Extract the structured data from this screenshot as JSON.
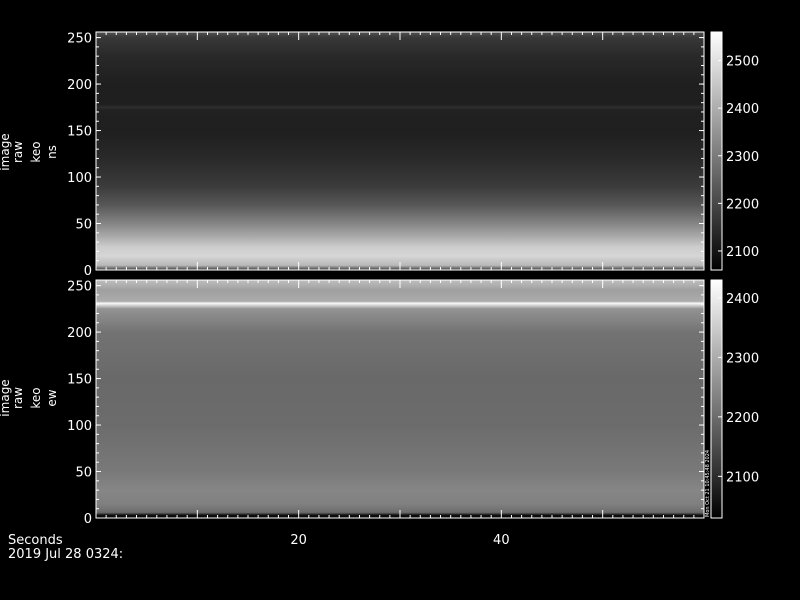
{
  "chart_data": [
    {
      "type": "heatmap",
      "ylabel_lines": [
        "image",
        "raw",
        "keo",
        "ns"
      ],
      "y_ticks": [
        0,
        50,
        100,
        150,
        200,
        250
      ],
      "ylim": [
        0,
        256
      ],
      "xlim": [
        0,
        60
      ],
      "colorbar": {
        "ticks": [
          2100,
          2200,
          2300,
          2400,
          2500
        ],
        "range": [
          2060,
          2560
        ],
        "palette": "grayscale"
      },
      "row_profile": [
        {
          "y": 0,
          "v": 2180
        },
        {
          "y": 5,
          "v": 2420
        },
        {
          "y": 15,
          "v": 2480
        },
        {
          "y": 25,
          "v": 2460
        },
        {
          "y": 35,
          "v": 2400
        },
        {
          "y": 50,
          "v": 2320
        },
        {
          "y": 70,
          "v": 2230
        },
        {
          "y": 90,
          "v": 2175
        },
        {
          "y": 120,
          "v": 2140
        },
        {
          "y": 150,
          "v": 2120
        },
        {
          "y": 172,
          "v": 2125
        },
        {
          "y": 175,
          "v": 2150
        },
        {
          "y": 178,
          "v": 2120
        },
        {
          "y": 200,
          "v": 2120
        },
        {
          "y": 230,
          "v": 2140
        },
        {
          "y": 250,
          "v": 2170
        },
        {
          "y": 256,
          "v": 2220
        }
      ]
    },
    {
      "type": "heatmap",
      "ylabel_lines": [
        "image",
        "raw",
        "keo",
        "ew"
      ],
      "y_ticks": [
        0,
        50,
        100,
        150,
        200,
        250
      ],
      "ylim": [
        0,
        256
      ],
      "xlim": [
        0,
        60
      ],
      "colorbar": {
        "ticks": [
          2100,
          2200,
          2300,
          2400
        ],
        "range": [
          2030,
          2430
        ],
        "palette": "grayscale"
      },
      "colorbar_annotation": "Mon Oct 21 10:45:48 2024",
      "row_profile": [
        {
          "y": 0,
          "v": 2040
        },
        {
          "y": 3,
          "v": 2050
        },
        {
          "y": 6,
          "v": 2200
        },
        {
          "y": 15,
          "v": 2230
        },
        {
          "y": 30,
          "v": 2240
        },
        {
          "y": 50,
          "v": 2220
        },
        {
          "y": 100,
          "v": 2200
        },
        {
          "y": 150,
          "v": 2195
        },
        {
          "y": 200,
          "v": 2210
        },
        {
          "y": 225,
          "v": 2260
        },
        {
          "y": 231,
          "v": 2420
        },
        {
          "y": 233,
          "v": 2300
        },
        {
          "y": 245,
          "v": 2280
        },
        {
          "y": 256,
          "v": 2330
        }
      ]
    }
  ],
  "x_axis": {
    "label": "Seconds",
    "ticks": [
      20,
      40
    ],
    "xlim": [
      0,
      60
    ]
  },
  "footer_date": "2019 Jul 28 0324:"
}
